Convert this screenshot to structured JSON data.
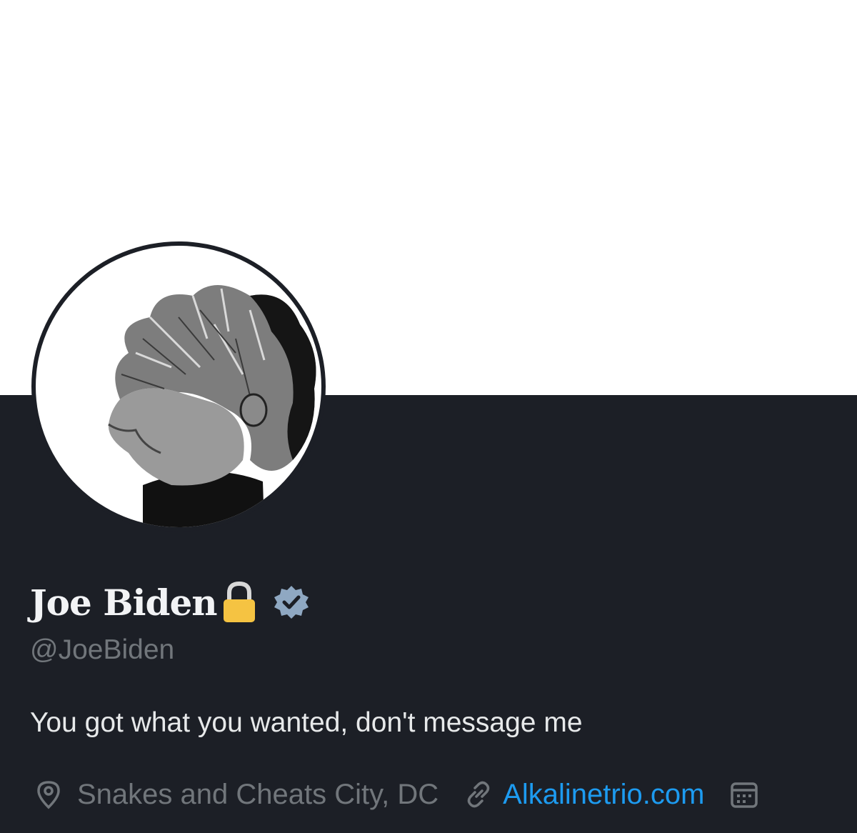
{
  "profile": {
    "display_name": "Joe Biden",
    "name_emoji": "lock-icon",
    "verified_badge": "verified-icon",
    "handle": "@JoeBiden",
    "bio": "You got what you wanted, don't message me",
    "location": "Snakes and Cheats City, DC",
    "website": "Alkalinetrio.com"
  },
  "icons": {
    "location": "location-pin-icon",
    "link": "link-icon",
    "calendar": "calendar-icon"
  },
  "colors": {
    "background": "#1c1f26",
    "banner": "#ffffff",
    "text_primary": "#e7e9ea",
    "text_secondary": "#71767b",
    "link": "#1d9bf0",
    "verified": "#8fa8c2",
    "lock": "#f5c342"
  }
}
